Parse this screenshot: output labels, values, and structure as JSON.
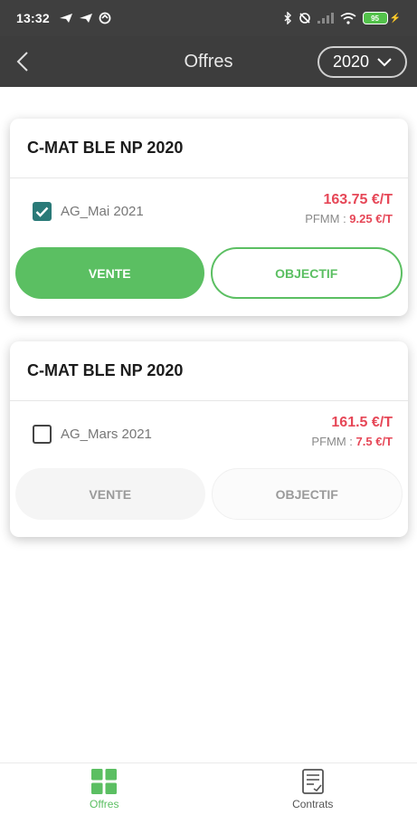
{
  "status_bar": {
    "time": "13:32",
    "battery": "95",
    "icons": [
      "send-icon",
      "send-icon",
      "sync-icon",
      "bluetooth-icon",
      "do-not-disturb-icon",
      "signal-icon",
      "wifi-icon",
      "battery-icon",
      "charging-icon"
    ]
  },
  "header": {
    "title": "Offres",
    "year_selected": "2020"
  },
  "cards": [
    {
      "title": "C-MAT BLE NP 2020",
      "offer_label": "AG_Mai 2021",
      "checked": true,
      "price": "163.75 €/T",
      "pfmm_label": "PFMM : ",
      "pfmm_value": "9.25 €/T",
      "vente_label": "VENTE",
      "objectif_label": "OBJECTIF"
    },
    {
      "title": "C-MAT BLE NP 2020",
      "offer_label": "AG_Mars 2021",
      "checked": false,
      "price": "161.5 €/T",
      "pfmm_label": "PFMM : ",
      "pfmm_value": "7.5 €/T",
      "vente_label": "VENTE",
      "objectif_label": "OBJECTIF"
    }
  ],
  "bottom_nav": {
    "items": [
      {
        "label": "Offres",
        "icon": "grid-icon",
        "active": true
      },
      {
        "label": "Contrats",
        "icon": "contract-icon",
        "active": false
      }
    ]
  },
  "colors": {
    "accent_green": "#5bbf62",
    "price_red": "#e64757",
    "checkbox_teal": "#2a7a78",
    "header_bg": "#3d3d3d"
  }
}
